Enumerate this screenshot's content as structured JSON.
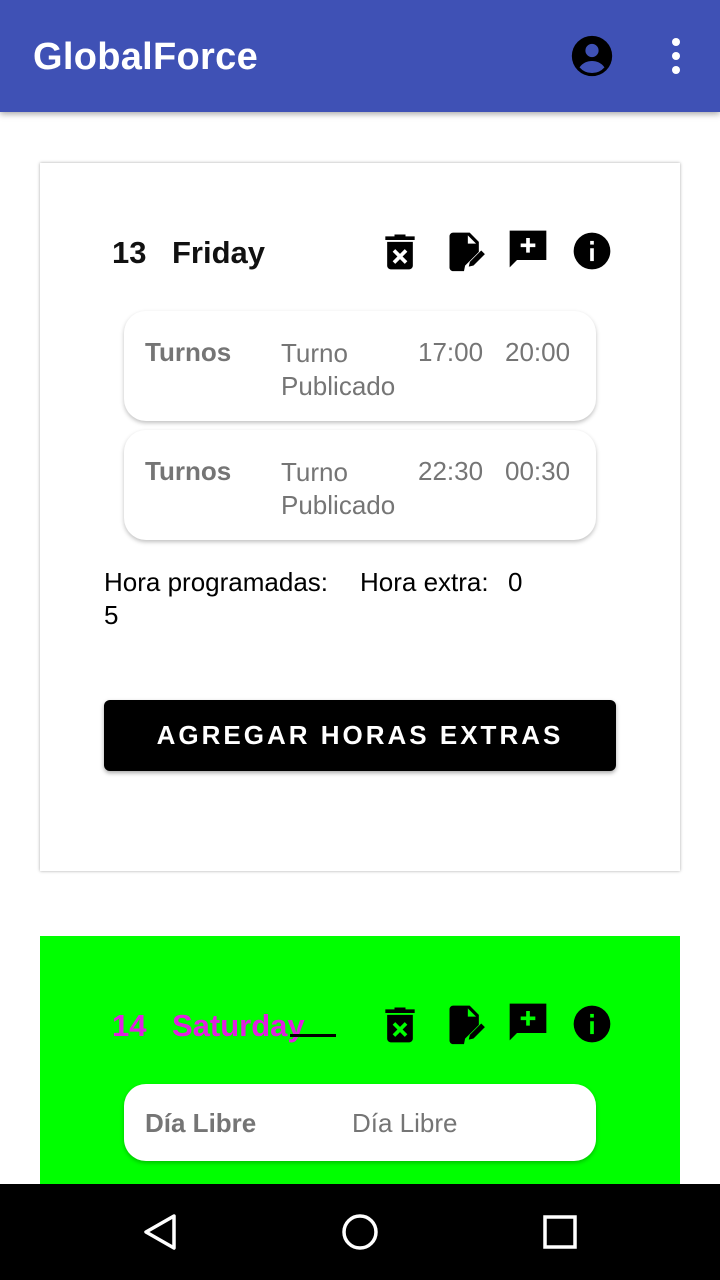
{
  "app": {
    "title": "GlobalForce",
    "primary_color": "#3f51b5",
    "account_icon": "account-circle-icon",
    "menu_icon": "more-vert-icon"
  },
  "day1": {
    "number": "13",
    "name": "Friday",
    "actions": [
      "delete-icon",
      "edit-note-icon",
      "add-comment-icon",
      "info-icon"
    ],
    "shifts": [
      {
        "type": "Turnos",
        "status": "Turno Publicado",
        "start": "17:00",
        "end": "20:00"
      },
      {
        "type": "Turnos",
        "status": "Turno Publicado",
        "start": "22:30",
        "end": "00:30"
      }
    ],
    "hours_label": "Hora programadas:",
    "hours_value": "5",
    "extra_label": "Hora extra:",
    "extra_value": "0",
    "button_label": "AGREGAR HORAS EXTRAS"
  },
  "day2": {
    "number": "14",
    "name": "Saturday",
    "background": "#00ff00",
    "text_color": "#e020e0",
    "entry": {
      "type": "Día Libre",
      "status": "Día Libre"
    }
  },
  "navbar": {
    "buttons": [
      "back-icon",
      "home-icon",
      "recents-icon"
    ]
  }
}
